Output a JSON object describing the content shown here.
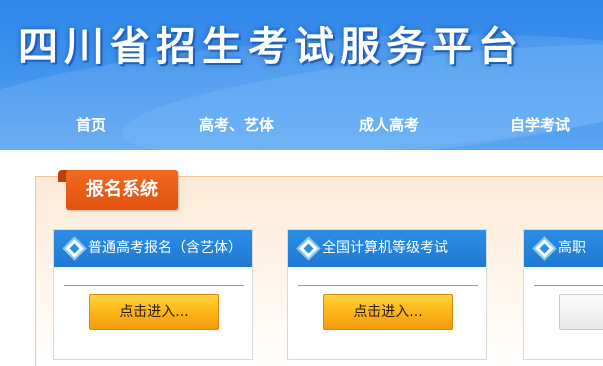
{
  "header": {
    "site_title": "四川省招生考试服务平台"
  },
  "nav": {
    "items": [
      {
        "label": "首页"
      },
      {
        "label": "高考、艺体"
      },
      {
        "label": "成人高考"
      },
      {
        "label": "自学考试"
      }
    ]
  },
  "section": {
    "tab_label": "报名系统"
  },
  "cards": [
    {
      "title": "普通高考报名（含艺体）",
      "button_label": "点击进入...",
      "icon": "diamond-icon"
    },
    {
      "title": "全国计算机等级考试",
      "button_label": "点击进入...",
      "icon": "diamond-icon"
    },
    {
      "title": "高职",
      "button_label": "",
      "icon": "diamond-icon"
    }
  ],
  "colors": {
    "banner_blue": "#3f93ee",
    "tab_orange": "#e2510f",
    "card_header_blue": "#2a8ee6",
    "button_yellow": "#fbb316"
  }
}
